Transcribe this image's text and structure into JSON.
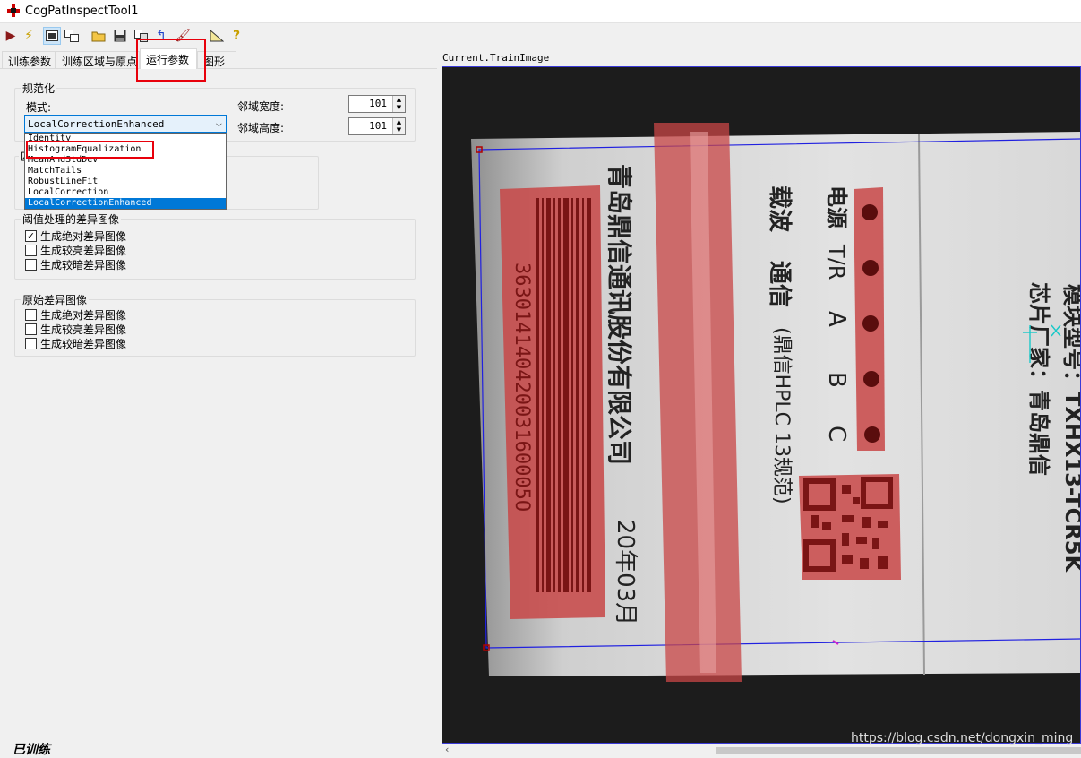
{
  "window": {
    "title": "CogPatInspectTool1"
  },
  "toolbar": {
    "buttons": [
      "run-icon",
      "lightning-icon",
      "image-icon",
      "display-icon",
      "open-folder-icon",
      "save-icon",
      "copy-icon",
      "undo-icon",
      "brush-icon",
      "ruler-icon",
      "help-icon"
    ]
  },
  "tabs": [
    {
      "label": "训练参数"
    },
    {
      "label": "训练区域与原点"
    },
    {
      "label": "运行参数",
      "active": true
    },
    {
      "label": "图形"
    }
  ],
  "normalization": {
    "group_title": "规范化",
    "mode_label": "模式:",
    "mode_value": "LocalCorrectionEnhanced",
    "options": [
      "Identity",
      "HistogramEqualization",
      "MeanAndStdDev",
      "MatchTails",
      "RobustLineFit",
      "LocalCorrection",
      "LocalCorrectionEnhanced"
    ],
    "selected_option": "LocalCorrectionEnhanced",
    "width_label": "邻域宽度:",
    "width_value": "101",
    "height_label": "邻域高度:",
    "height_value": "101"
  },
  "hidden_group": {
    "title_fragment": "匹"
  },
  "threshold_group": {
    "title": "阈值处理的差异图像",
    "items": [
      {
        "label": "生成绝对差异图像",
        "checked": true,
        "mark": "✓"
      },
      {
        "label": "生成较亮差异图像",
        "checked": false,
        "mark": ""
      },
      {
        "label": "生成较暗差异图像",
        "checked": false,
        "mark": ""
      }
    ]
  },
  "raw_group": {
    "title": "原始差异图像",
    "items": [
      {
        "label": "生成绝对差异图像",
        "checked": false,
        "mark": ""
      },
      {
        "label": "生成较亮差异图像",
        "checked": false,
        "mark": ""
      },
      {
        "label": "生成较暗差异图像",
        "checked": false,
        "mark": ""
      }
    ]
  },
  "status": {
    "text": "已训练"
  },
  "image": {
    "caption": "Current.TrainImage",
    "label_texts": {
      "company": "青岛鼎信通讯股份有限公司",
      "serial": "36301414042003160005O",
      "date": "20年03月",
      "carrier": "载波",
      "comm": "通信",
      "power": "电源",
      "tr": "T/R",
      "a": "A",
      "b": "B",
      "c": "C",
      "spec": "(鼎信HPLC 13规范)",
      "model": "模块型号：TXHX13-TCR5K",
      "vendor": "芯片厂家：青岛鼎信"
    }
  },
  "watermark": "https://blog.csdn.net/dongxin_ming",
  "colors": {
    "highlight_red": "#e8000b",
    "selection_blue": "#0078d7",
    "mask_red": "#c84646"
  }
}
